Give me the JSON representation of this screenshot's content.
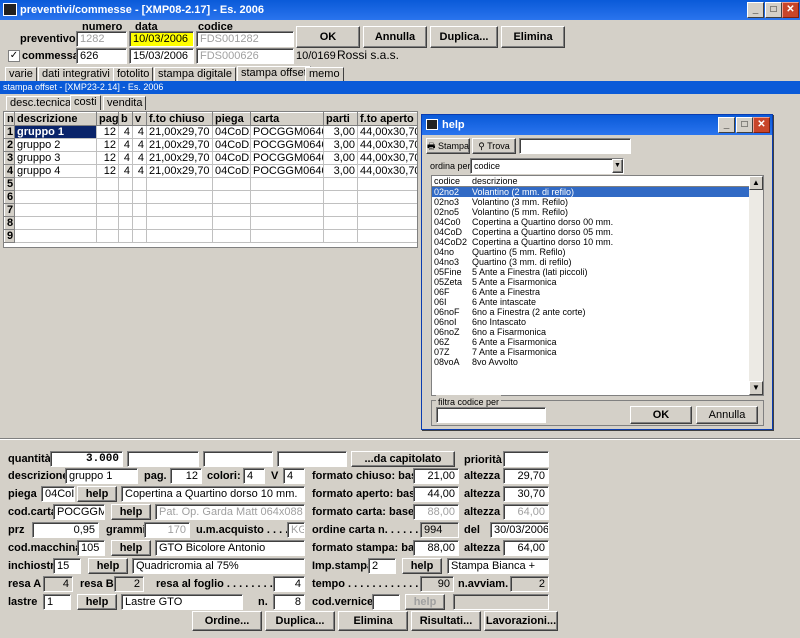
{
  "window": {
    "title": "preventivi/commesse - [XMP08-2.17] - Es. 2006",
    "min": "_",
    "max": "□",
    "close": "✕"
  },
  "header": {
    "col_numero": "numero",
    "col_data": "data",
    "col_codice": "codice",
    "preventivo_label": "preventivo",
    "preventivo_numero": "1282",
    "preventivo_data": "10/03/2006",
    "preventivo_codice": "FDS001282",
    "commessa_label": "commessa",
    "commessa_numero": "626",
    "commessa_data": "15/03/2006",
    "commessa_codice": "FDS000626",
    "cliente_codice": "10/0169",
    "cliente_nome": "Rossi s.a.s.",
    "ok": "OK",
    "annulla": "Annulla",
    "duplica": "Duplica...",
    "elimina": "Elimina"
  },
  "tabs": [
    "varie",
    "dati integrativi",
    "fotolito",
    "stampa digitale",
    "stampa offset",
    "memo"
  ],
  "inner_title": "stampa offset - [XMP23-2.14] - Es. 2006",
  "subtabs": [
    "desc.tecnica",
    "costi",
    "vendita"
  ],
  "grid": {
    "headers": [
      "n",
      "descrizione",
      "pag",
      "b",
      "v",
      "f.to chiuso",
      "piega",
      "carta",
      "parti",
      "f.to aperto"
    ],
    "rows": [
      [
        "1",
        "gruppo 1",
        "12",
        "4",
        "4",
        "21,00x29,70",
        "04CoD2",
        "POCGGM064088",
        "3,00",
        "44,00x30,70"
      ],
      [
        "2",
        "gruppo 2",
        "12",
        "4",
        "4",
        "21,00x29,70",
        "04CoD2",
        "POCGGM064088",
        "3,00",
        "44,00x30,70"
      ],
      [
        "3",
        "gruppo 3",
        "12",
        "4",
        "4",
        "21,00x29,70",
        "04CoD2",
        "POCGGM064088",
        "3,00",
        "44,00x30,70"
      ],
      [
        "4",
        "gruppo 4",
        "12",
        "4",
        "4",
        "21,00x29,70",
        "04CoD2",
        "POCGGM064088",
        "3,00",
        "44,00x30,70"
      ],
      [
        "5"
      ],
      [
        "6"
      ],
      [
        "7"
      ],
      [
        "8"
      ],
      [
        "9"
      ]
    ]
  },
  "help": {
    "title": "help",
    "stampa": "Stampa",
    "trova": "Trova",
    "ordina_label": "ordina per",
    "ordina_value": "codice",
    "col_codice": "codice",
    "col_descrizione": "descrizione",
    "items": [
      [
        "02no2",
        "Volantino (2 mm. di refilo)"
      ],
      [
        "02no3",
        "Volantino (3 mm. Refilo)"
      ],
      [
        "02no5",
        "Volantino (5 mm. Refilo)"
      ],
      [
        "04Co0",
        "Copertina a Quartino dorso 00 mm."
      ],
      [
        "04CoD",
        "Copertina a Quartino dorso 05 mm."
      ],
      [
        "04CoD2",
        "Copertina a Quartino dorso 10 mm."
      ],
      [
        "04no",
        "Quartino (5 mm. Refilo)"
      ],
      [
        "04no3",
        "Quartino (3 mm. di refilo)"
      ],
      [
        "05Fine",
        "5 Ante a Finestra (lati piccoli)"
      ],
      [
        "05Zeta",
        "5 Ante a Fisarmonica"
      ],
      [
        "06F",
        "6 Ante a Finestra"
      ],
      [
        "06I",
        "6 Ante intascate"
      ],
      [
        "06noF",
        "6no a Finestra (2 ante corte)"
      ],
      [
        "06noI",
        "6no Intascato"
      ],
      [
        "06noZ",
        "6no a Fisarmonica"
      ],
      [
        "06Z",
        "6 Ante a Fisarmonica"
      ],
      [
        "07Z",
        "7 Ante a Fisarmonica"
      ],
      [
        "08voA",
        "8vo Avvolto"
      ]
    ],
    "filtro_label": "filtra codice per",
    "ok": "OK",
    "annulla": "Annulla"
  },
  "form": {
    "quantita_label": "quantità",
    "quantita": "3.000",
    "da_capitolato": "...da capitolato",
    "priorita_label": "priorità",
    "descrizione_label": "descrizione",
    "descrizione": "gruppo 1",
    "pag_label": "pag.",
    "pag": "12",
    "colori_label": "colori:",
    "colori": "4",
    "v_label": "V",
    "v": "4",
    "fchiuso_label": "formato chiuso: base",
    "fchiuso_base": "21,00",
    "altezza_label": "altezza",
    "fchiuso_alt": "29,70",
    "piega_label": "piega",
    "piega": "04CoI",
    "help": "help",
    "piega_desc": "Copertina a Quartino dorso 10 mm.",
    "faperto_label": "formato aperto: base",
    "faperto_base": "44,00",
    "faperto_alt": "30,70",
    "codcarta_label": "cod.carta",
    "codcarta": "POCGGM0",
    "carta_desc": "Pat. Op. Garda Matt 064x088 g.1",
    "fcarta_label": "formato carta: base",
    "fcarta_base": "88,00",
    "fcarta_alt": "64,00",
    "prz_label": "prz",
    "prz": "0,95",
    "grammi_label": "grammi",
    "grammi": "170",
    "um_label": "u.m.acquisto . . . . . .",
    "um": "KG",
    "ordine_label": "ordine carta n. . . . . . . . .",
    "ordine": "994",
    "del_label": "del",
    "del": "30/03/2006",
    "codmacchina_label": "cod.macchina",
    "codmacchina": "105",
    "macchina_desc": "GTO Bicolore Antonio",
    "fstampa_label": "formato stampa: base",
    "fstampa_base": "88,00",
    "fstampa_alt": "64,00",
    "inchiostro_label": "inchiostro",
    "inchiostro": "15",
    "inchiostro_desc": "Quadricromia al 75%",
    "impstampa_label": "Imp.stampa",
    "impstampa": "2",
    "impstampa_desc": "Stampa Bianca +",
    "resaA_label": "resa A",
    "resaA": "4",
    "resaB_label": "resa B",
    "resaB": "2",
    "resafoglio_label": "resa al foglio . . . . . . . . .",
    "resafoglio": "4",
    "tempo_label": "tempo . . . . . . . . . . . . . .",
    "tempo": "90",
    "navviam_label": "n.avviam.",
    "navviam": "2",
    "lastre_label": "lastre",
    "lastre": "1",
    "lastre_desc": "Lastre GTO",
    "n_label": "n.",
    "n": "8",
    "codvernice_label": "cod.vernice"
  },
  "bottom": {
    "ordine": "Ordine...",
    "duplica": "Duplica...",
    "elimina": "Elimina",
    "risultati": "Risultati...",
    "lavorazioni": "Lavorazioni..."
  }
}
